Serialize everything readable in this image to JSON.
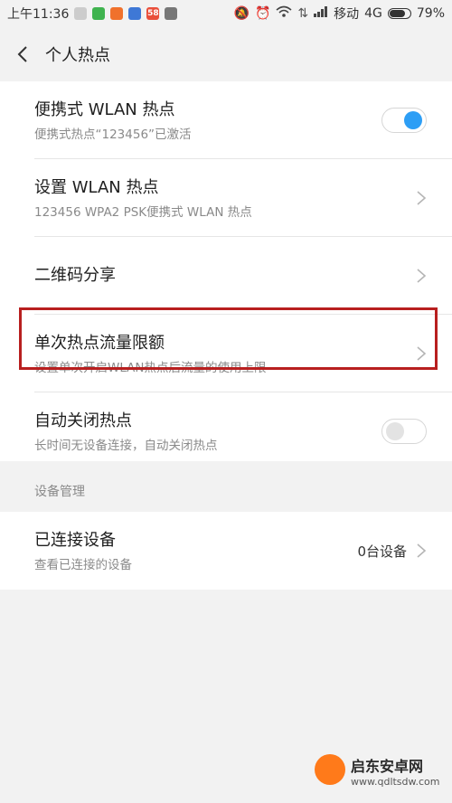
{
  "status_bar": {
    "time": "上午11:36",
    "carrier": "移动",
    "network": "4G",
    "battery": "79%",
    "battery_level": 0.79,
    "left_icons": [
      "app-icon-green",
      "app-icon-orange",
      "app-icon-blue",
      "app-icon-58",
      "app-icon-gray"
    ],
    "right_icons": [
      "mute-icon",
      "alarm-icon",
      "wifi-icon",
      "data-arrows-icon",
      "signal-icon"
    ]
  },
  "header": {
    "title": "个人热点"
  },
  "settings": {
    "portable_wlan": {
      "label": "便携式 WLAN 热点",
      "sub": "便携式热点“123456”已激活",
      "enabled": true
    },
    "setup_wlan": {
      "label": "设置 WLAN 热点",
      "sub": "123456 WPA2 PSK便携式 WLAN 热点"
    },
    "qr_share": {
      "label": "二维码分享"
    },
    "data_limit": {
      "label": "单次热点流量限额",
      "sub": "设置单次开启WLAN热点后流量的使用上限"
    },
    "auto_close": {
      "label": "自动关闭热点",
      "sub": "长时间无设备连接，自动关闭热点",
      "enabled": false
    }
  },
  "device_management": {
    "section_title": "设备管理",
    "connected": {
      "label": "已连接设备",
      "sub": "查看已连接的设备",
      "count": "0台设备"
    }
  },
  "watermark": {
    "name": "启东安卓网",
    "url": "www.qdltsdw.com"
  },
  "colors": {
    "toggle_on": "#2d9ef5",
    "highlight": "#b81f1f"
  }
}
